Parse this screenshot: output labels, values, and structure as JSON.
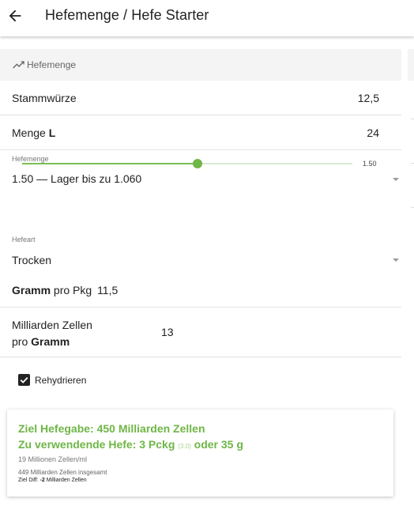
{
  "header": {
    "title": "Hefemenge / Hefe Starter"
  },
  "section": {
    "title": "Hefemenge",
    "icon": "trending-up-icon"
  },
  "stammwuerze": {
    "label": "Stammwürze",
    "value": "12,5"
  },
  "menge": {
    "label": "Menge",
    "unit": "L",
    "value": "24"
  },
  "hefemenge": {
    "label": "Hefemenge",
    "selected": "1.50 — Lager bis zu 1.060",
    "slider_value": "1.50",
    "slider_fraction": 0.53
  },
  "hefeart": {
    "label": "Hefeart",
    "selected": "Trocken"
  },
  "gramm_pkg": {
    "bold": "Gramm",
    "rest": "pro Pkg",
    "value": "11,5"
  },
  "zellen": {
    "line1": "Milliarden Zellen",
    "line2_pre": "pro",
    "line2_bold": "Gramm",
    "value": "13"
  },
  "rehydrieren": {
    "label": "Rehydrieren",
    "checked": true
  },
  "result": {
    "ziel": "Ziel Hefegabe: 450 Milliarden Zellen",
    "verwenden_pre": "Zu verwendende Hefe: 3 Pckg",
    "verwenden_dim": "(3.0)",
    "verwenden_post": "oder 35 g",
    "zellen_ml": "19 Millionen Zellen/ml",
    "insgesamt": "449 Milliarden Zellen insgesamt",
    "diff_pre": "Ziel Diff:",
    "diff_bold": "-2",
    "diff_post": "Milliarden Zellen"
  },
  "colors": {
    "accent": "#6fb646"
  }
}
